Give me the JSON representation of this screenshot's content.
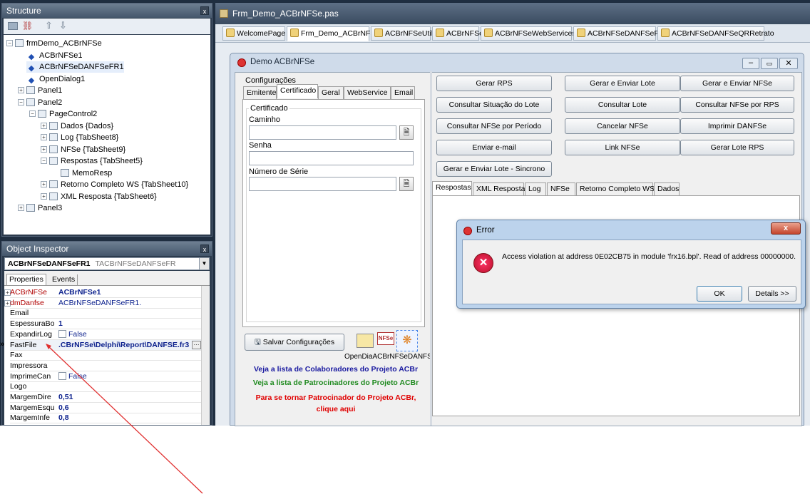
{
  "structure": {
    "title": "Structure",
    "close": "x",
    "toolbar_icons": [
      "structure-tool-icon",
      "link-icon",
      "up-arrow-icon",
      "down-arrow-icon"
    ],
    "tree": [
      {
        "label": "frmDemo_ACBrNFSe",
        "level": 0,
        "expander": "−",
        "icon": "form"
      },
      {
        "label": "ACBrNFSe1",
        "level": 1,
        "icon": "comp"
      },
      {
        "label": "ACBrNFSeDANFSeFR1",
        "level": 1,
        "icon": "comp",
        "selected": true
      },
      {
        "label": "OpenDialog1",
        "level": 1,
        "icon": "comp"
      },
      {
        "label": "Panel1",
        "level": 1,
        "expander": "+",
        "icon": "panel"
      },
      {
        "label": "Panel2",
        "level": 1,
        "expander": "−",
        "icon": "panel"
      },
      {
        "label": "PageControl2",
        "level": 2,
        "expander": "−",
        "icon": "panel"
      },
      {
        "label": "Dados {Dados}",
        "level": 3,
        "expander": "+",
        "icon": "panel"
      },
      {
        "label": "Log {TabSheet8}",
        "level": 3,
        "expander": "+",
        "icon": "panel"
      },
      {
        "label": "NFSe {TabSheet9}",
        "level": 3,
        "expander": "+",
        "icon": "panel"
      },
      {
        "label": "Respostas {TabSheet5}",
        "level": 3,
        "expander": "−",
        "icon": "panel"
      },
      {
        "label": "MemoResp",
        "level": 4,
        "icon": "panel"
      },
      {
        "label": "Retorno Completo WS {TabSheet10}",
        "level": 3,
        "expander": "+",
        "icon": "panel"
      },
      {
        "label": "XML Resposta {TabSheet6}",
        "level": 3,
        "expander": "+",
        "icon": "panel"
      },
      {
        "label": "Panel3",
        "level": 1,
        "expander": "+",
        "icon": "panel"
      }
    ]
  },
  "inspector": {
    "title": "Object Inspector",
    "close": "x",
    "object_name": "ACBrNFSeDANFSeFR1",
    "object_type": "TACBrNFSeDANFSeFR",
    "tabs": [
      "Properties",
      "Events"
    ],
    "rows": [
      {
        "name": "ACBrNFSe",
        "value": "ACBrNFSe1",
        "red": true,
        "expander": "+"
      },
      {
        "name": "dmDanfse",
        "value": "ACBrNFSeDANFSeFR1.",
        "red": true,
        "expander": "+",
        "plain": true
      },
      {
        "name": "Email",
        "value": ""
      },
      {
        "name": "EspessuraBo",
        "value": "1"
      },
      {
        "name": "ExpandirLog",
        "value": "False",
        "checkbox": true
      },
      {
        "name": "FastFile",
        "value": ".CBrNFSe\\Delphi\\Report\\DANFSE.fr3",
        "active": true
      },
      {
        "name": "Fax",
        "value": ""
      },
      {
        "name": "Impressora",
        "value": ""
      },
      {
        "name": "ImprimeCan",
        "value": "False",
        "checkbox": true
      },
      {
        "name": "Logo",
        "value": ""
      },
      {
        "name": "MargemDire",
        "value": "0,51"
      },
      {
        "name": "MargemEsqu",
        "value": "0,6"
      },
      {
        "name": "MargemInfe",
        "value": "0,8"
      }
    ],
    "active_marker": "»",
    "ellipsis": "···"
  },
  "editor": {
    "title": "Frm_Demo_ACBrNFSe.pas",
    "tabs": [
      "WelcomePage",
      "Frm_Demo_ACBrNFSe",
      "ACBrNFSeUtil",
      "ACBrNFSe",
      "ACBrNFSeWebServices",
      "ACBrNFSeDANFSeFR",
      "ACBrNFSeDANFSeQRRetrato"
    ]
  },
  "demo": {
    "title": "Demo ACBrNFSe",
    "config_label": "Configurações",
    "config_tabs": [
      "Emitente",
      "Certificado",
      "Geral",
      "WebService",
      "Email"
    ],
    "group_label": "Certificado",
    "caminho_label": "Caminho",
    "senha_label": "Senha",
    "serie_label": "Número de Série",
    "save_label": "Salvar Configurações",
    "component_caption": "OpenDiaACBrNFSeDANFSeFR1",
    "nfse_icon_text": "NFSe",
    "link1": "Veja a lista de Colaboradores do Projeto ACBr",
    "link2": "Veja a lista de Patrocinadores do Projeto ACBr",
    "link3a": "Para se tornar Patrocinador do Projeto ACBr,",
    "link3b": "clique aqui",
    "buttons": [
      [
        "Gerar RPS",
        "Gerar e Enviar Lote",
        "Gerar e Enviar NFSe"
      ],
      [
        "Consultar Situação do Lote",
        "Consultar Lote",
        "Consultar NFSe por RPS"
      ],
      [
        "Consultar NFSe por Período",
        "Cancelar NFSe",
        "Imprimir DANFSe"
      ],
      [
        "Enviar e-mail",
        "Link NFSe",
        "Gerar Lote RPS"
      ],
      [
        "Gerar e Enviar Lote - Sincrono"
      ]
    ],
    "result_tabs": [
      "Respostas",
      "XML Resposta",
      "Log",
      "NFSe",
      "Retorno Completo WS",
      "Dados"
    ]
  },
  "error": {
    "title": "Error",
    "message": "Access violation at address 0E02CB75 in module 'frx16.bpl'. Read of address 00000000.",
    "ok_label": "OK",
    "details_label": "Details >>",
    "close": "x"
  },
  "colors": {
    "link1": "#1a1aa0",
    "link2": "#1f8a1f",
    "link3": "#e00000",
    "arrow": "#e03030"
  }
}
